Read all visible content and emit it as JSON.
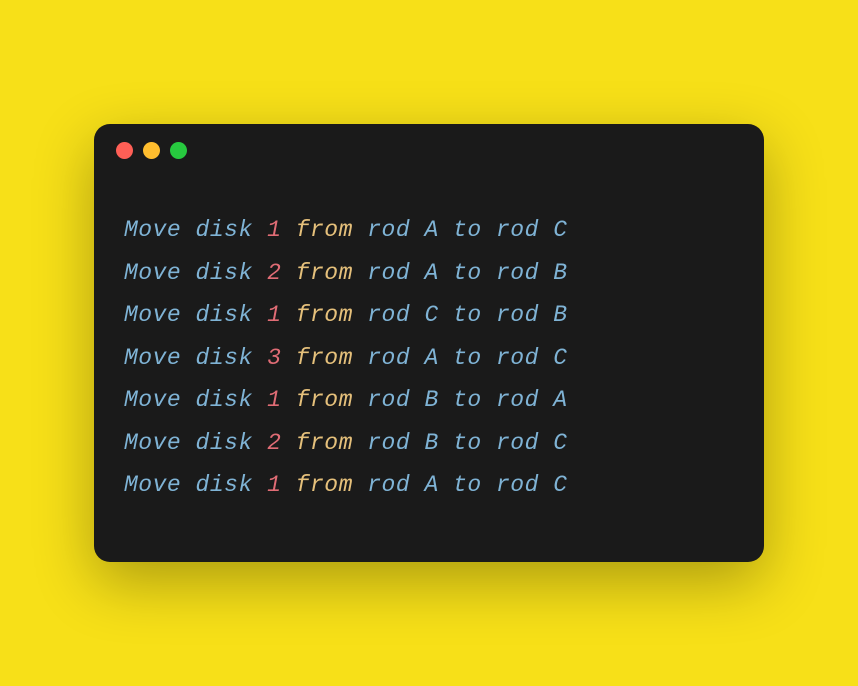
{
  "colors": {
    "background": "#f7e018",
    "terminal": "#1a1a1a",
    "dot_red": "#ff5f56",
    "dot_yellow": "#ffbd2e",
    "dot_green": "#27c93f",
    "token_default": "#7fb3d5",
    "token_number": "#e06c75",
    "token_keyword": "#e5c07b"
  },
  "tokens": {
    "move": "Move",
    "disk": "disk",
    "from": "from",
    "rod": "rod",
    "to": "to"
  },
  "lines": [
    {
      "disk": "1",
      "from": "A",
      "to": "C"
    },
    {
      "disk": "2",
      "from": "A",
      "to": "B"
    },
    {
      "disk": "1",
      "from": "C",
      "to": "B"
    },
    {
      "disk": "3",
      "from": "A",
      "to": "C"
    },
    {
      "disk": "1",
      "from": "B",
      "to": "A"
    },
    {
      "disk": "2",
      "from": "B",
      "to": "C"
    },
    {
      "disk": "1",
      "from": "A",
      "to": "C"
    }
  ]
}
